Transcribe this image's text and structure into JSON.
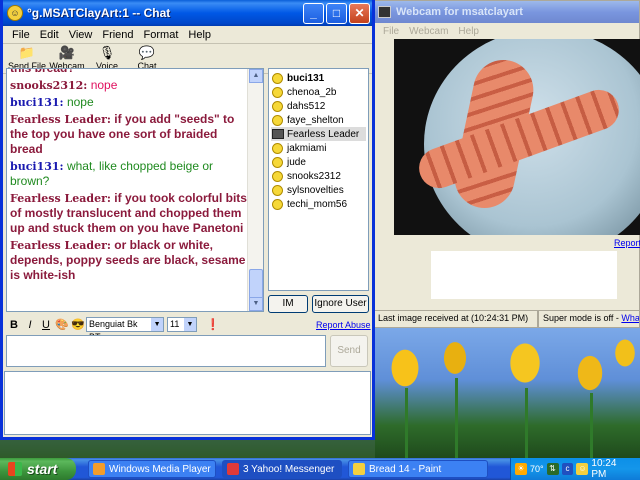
{
  "chat_window": {
    "title": "°g.MSATClayArt:1 -- Chat",
    "menu": [
      "File",
      "Edit",
      "View",
      "Friend",
      "Format",
      "Help"
    ],
    "toolbar": [
      {
        "label": "Send File",
        "icon": "send-file-icon"
      },
      {
        "label": "Webcam",
        "icon": "webcam-icon"
      },
      {
        "label": "Voice",
        "icon": "microphone-icon"
      },
      {
        "label": "Chat",
        "icon": "chat-bubbles-icon"
      }
    ],
    "messages": [
      {
        "name": "",
        "text": "this bread?",
        "style": "maroon"
      },
      {
        "name": "snooks2312:",
        "text": "nope",
        "style": "red"
      },
      {
        "name": "buci131:",
        "text": "nope",
        "style": "blue"
      },
      {
        "name": "Fearless Leader:",
        "text": "if you add \"seeds\" to the top you have one sort of braided bread",
        "style": "maroon"
      },
      {
        "name": "buci131:",
        "text": "what, like chopped beige or brown?",
        "style": "green"
      },
      {
        "name": "Fearless Leader:",
        "text": "if you took colorful bits of mostly translucent and chopped them up and stuck them on you have Panetoni",
        "style": "maroon"
      },
      {
        "name": "Fearless Leader:",
        "text": "or black or white, depends, poppy seeds are black, sesame is white-ish",
        "style": "maroon"
      }
    ],
    "users": [
      {
        "name": "buci131",
        "bold": true,
        "icon": "smiley"
      },
      {
        "name": "chenoa_2b",
        "bold": false,
        "icon": "smiley"
      },
      {
        "name": "dahs512",
        "bold": false,
        "icon": "smiley"
      },
      {
        "name": "faye_shelton",
        "bold": false,
        "icon": "smiley"
      },
      {
        "name": "Fearless Leader",
        "bold": false,
        "icon": "webcam",
        "selected": true
      },
      {
        "name": "jakmiami",
        "bold": false,
        "icon": "smiley"
      },
      {
        "name": "jude",
        "bold": false,
        "icon": "smiley"
      },
      {
        "name": "snooks2312",
        "bold": false,
        "icon": "smiley"
      },
      {
        "name": "sylsnovelties",
        "bold": false,
        "icon": "smiley"
      },
      {
        "name": "techi_mom56",
        "bold": false,
        "icon": "smiley"
      }
    ],
    "im_label": "IM",
    "ignore_label": "Ignore User",
    "format": {
      "bold": "B",
      "italic": "I",
      "underline": "U",
      "font": "Benguiat Bk BT",
      "size": "11"
    },
    "report_abuse": "Report Abuse",
    "send_label": "Send"
  },
  "webcam_window": {
    "title": "Webcam for msatclayart",
    "menu": [
      "File",
      "Webcam",
      "Help"
    ],
    "report": "Report",
    "status_last": "Last image received at (10:24:31 PM)",
    "status_mode": "Super mode is off - ",
    "status_link": "What's"
  },
  "taskbar": {
    "start": "start",
    "tasks": [
      {
        "label": "Windows Media Player",
        "color": "#f39c2a"
      },
      {
        "label": "3 Yahoo! Messenger",
        "color": "#e03a3a"
      },
      {
        "label": "Bread 14 - Paint",
        "color": "#f4d03f"
      }
    ],
    "tray": {
      "temp": "70°",
      "clock": "10:24 PM"
    }
  }
}
